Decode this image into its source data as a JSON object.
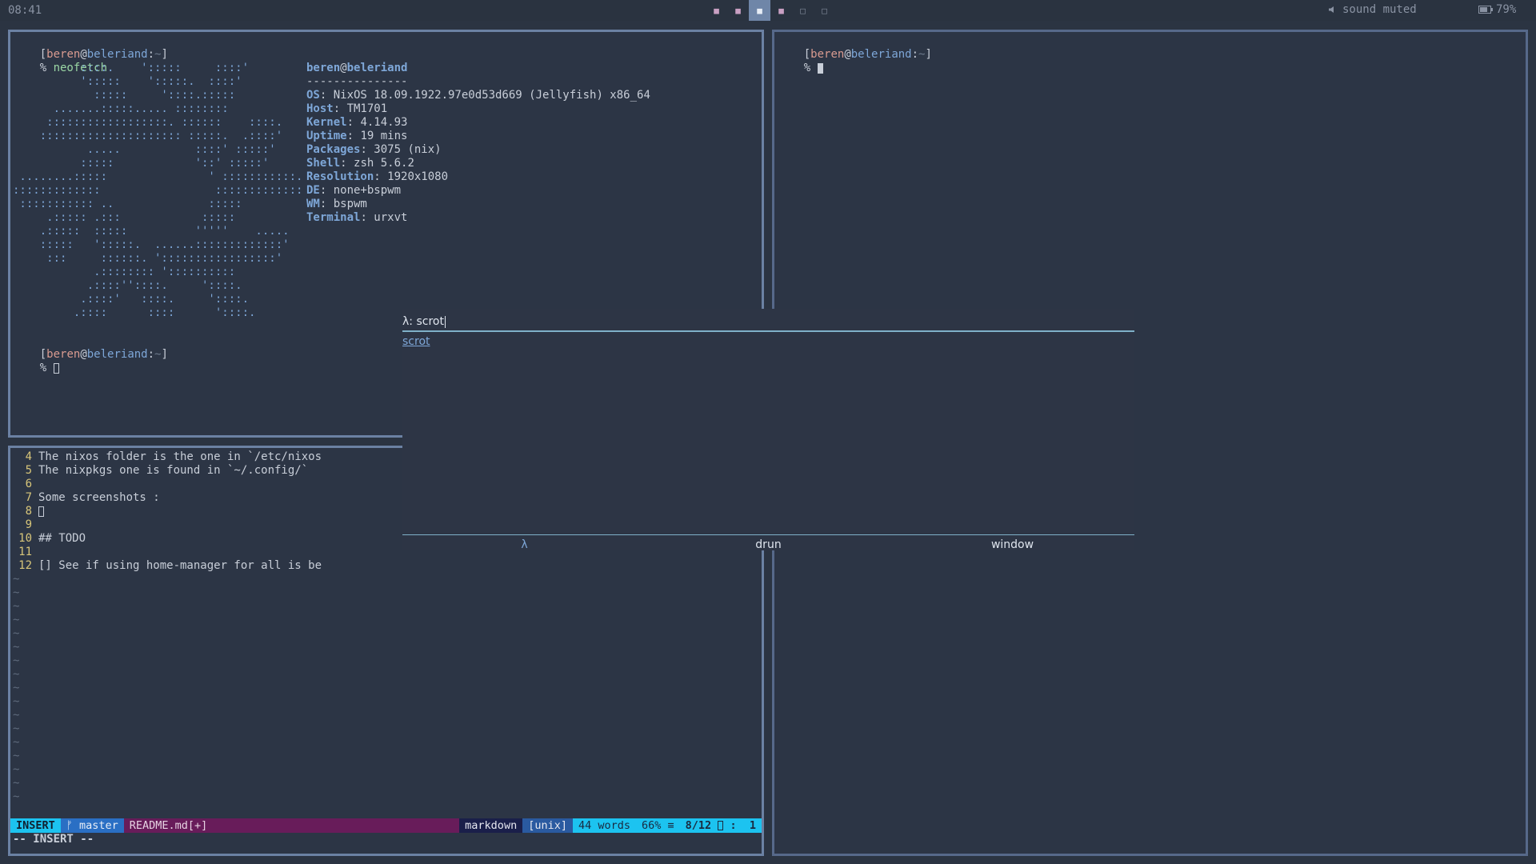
{
  "topbar": {
    "clock": "08:41",
    "workspaces": [
      {
        "glyph": "■",
        "state": "occupied"
      },
      {
        "glyph": "■",
        "state": "occupied"
      },
      {
        "glyph": "■",
        "state": "active"
      },
      {
        "glyph": "■",
        "state": "occupied"
      },
      {
        "glyph": "□",
        "state": "empty"
      },
      {
        "glyph": "□",
        "state": "empty"
      }
    ],
    "sound_icon": "speaker-icon",
    "sound_text": "sound muted",
    "battery_icon": "battery-icon",
    "battery_text": "79%",
    "battery_level": 0.79
  },
  "term_left": {
    "prompt1": {
      "open": "[",
      "user": "beren",
      "at": "@",
      "host": "beleriand",
      "colon": ":",
      "path": "~",
      "close": "]"
    },
    "cmd_prefix": "% ",
    "cmd": "neofetch",
    "logo": [
      "          ::::.    ':::::     ::::'",
      "          ':::::    ':::::.  ::::'",
      "            :::::     '::::.:::::",
      "      .......:::::..... ::::::::",
      "     ::::::::::::::::::. ::::::    ::::.",
      "    ::::::::::::::::::::: :::::.  .::::'",
      "           .....           ::::' :::::'",
      "          :::::            '::' :::::'",
      " ........:::::               ' :::::::::::.",
      ":::::::::::::                 :::::::::::::",
      " ::::::::::: ..              :::::",
      "     .::::: .:::            :::::",
      "    .:::::  :::::          '''''    .....",
      "    :::::   ':::::.  ......:::::::::::::'",
      "     :::     ::::::. ':::::::::::::::::'",
      "            .:::::::: '::::::::::",
      "           .::::''::::.     '::::.",
      "          .::::'   ::::.     '::::.",
      "         .::::      ::::      '::::."
    ],
    "info_user": "beren",
    "info_at": "@",
    "info_host": "beleriand",
    "info_sep": "---------------",
    "info": [
      {
        "label": "OS",
        "value": "NixOS 18.09.1922.97e0d53d669 (Jellyfish) x86_64"
      },
      {
        "label": "Host",
        "value": "TM1701"
      },
      {
        "label": "Kernel",
        "value": "4.14.93"
      },
      {
        "label": "Uptime",
        "value": "19 mins"
      },
      {
        "label": "Packages",
        "value": "3075 (nix)"
      },
      {
        "label": "Shell",
        "value": "zsh 5.6.2"
      },
      {
        "label": "Resolution",
        "value": "1920x1080"
      },
      {
        "label": "DE",
        "value": "none+bspwm"
      },
      {
        "label": "WM",
        "value": "bspwm"
      },
      {
        "label": "Terminal",
        "value": "urxvt"
      }
    ],
    "prompt2": {
      "open": "[",
      "user": "beren",
      "at": "@",
      "host": "beleriand",
      "colon": ":",
      "path": "~",
      "close": "]"
    },
    "prompt2_prefix": "% "
  },
  "term_right": {
    "prompt": {
      "open": "[",
      "user": "beren",
      "at": "@",
      "host": "beleriand",
      "colon": ":",
      "path": "~",
      "close": "]"
    },
    "prefix": "% "
  },
  "vim": {
    "lines": [
      {
        "num": "4",
        "text": "The nixos folder is the one in `/etc/nixos"
      },
      {
        "num": "5",
        "text": "The nixpkgs one is found in `~/.config/`"
      },
      {
        "num": "6",
        "text": ""
      },
      {
        "num": "7",
        "text": "Some screenshots :"
      },
      {
        "num": "8",
        "text": ""
      },
      {
        "num": "9",
        "text": ""
      },
      {
        "num": "10",
        "text": "## TODO"
      },
      {
        "num": "11",
        "text": ""
      },
      {
        "num": "12",
        "text": "[] See if using home-manager for all is be"
      }
    ],
    "tilde": "~",
    "tilde_count": 17,
    "status": {
      "mode": "INSERT",
      "branch": "ᚠ master",
      "file": "README.md[+]",
      "filetype": "markdown",
      "format": "[unix]",
      "words": "44 words",
      "percent": "66% ≡",
      "position": "8/12",
      "col_sep": ":",
      "col": "1"
    },
    "mode_line": "-- INSERT --"
  },
  "launcher": {
    "prompt_label": "λ:",
    "input_value": "scrot",
    "result": "scrot",
    "modes": [
      {
        "label": "λ",
        "active": true
      },
      {
        "label": "drun",
        "active": false
      },
      {
        "label": "window",
        "active": false
      }
    ]
  }
}
